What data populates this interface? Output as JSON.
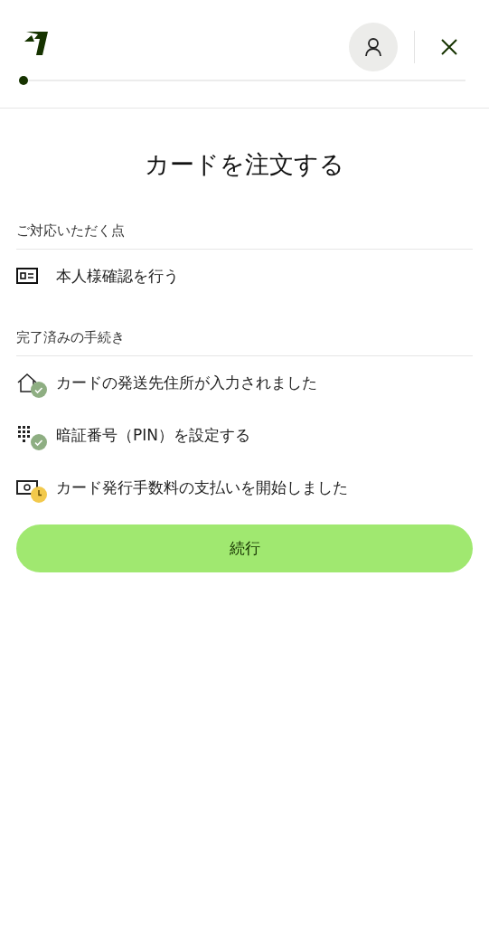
{
  "progress": {
    "level": 0
  },
  "title": "カードを注文する",
  "sections": [
    {
      "heading": "ご対応いただく点",
      "items": [
        {
          "label": "本人様確認を行う",
          "kind": "id-card",
          "completed": false,
          "in_progress": false
        }
      ]
    },
    {
      "heading": "完了済みの手続き",
      "items": [
        {
          "label": "カードの発送先住所が入力されました",
          "kind": "home",
          "completed": true,
          "in_progress": false
        },
        {
          "label": "暗証番号（PIN）を設定する",
          "kind": "keypad",
          "completed": true,
          "in_progress": false
        },
        {
          "label": "カード発行手数料の支払いを開始しました",
          "kind": "cash",
          "completed": false,
          "in_progress": true
        }
      ]
    }
  ],
  "button": "続行"
}
